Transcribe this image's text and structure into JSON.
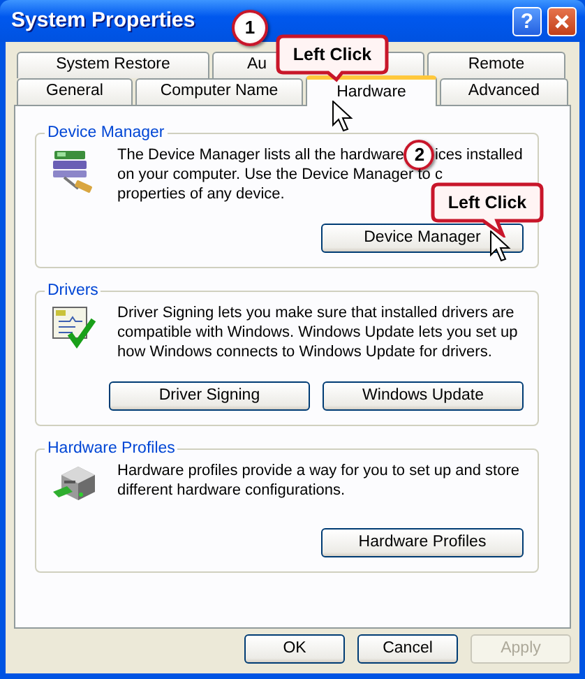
{
  "window": {
    "title": "System Properties",
    "help_button": "?"
  },
  "tab_rows": [
    [
      {
        "label": "System Restore",
        "selected": false
      },
      {
        "label": "Au",
        "selected": false
      },
      {
        "label": "Remote",
        "selected": false
      }
    ],
    [
      {
        "label": "General",
        "selected": false
      },
      {
        "label": "Computer Name",
        "selected": false
      },
      {
        "label": "Hardware",
        "selected": true
      },
      {
        "label": "Advanced",
        "selected": false
      }
    ]
  ],
  "groups": [
    {
      "title": "Device Manager",
      "kind": "device_manager",
      "lines": [
        [
          {
            "kind": "text",
            "text": "The Device Manager lists all the hardware"
          },
          {
            "kind": "step",
            "number": "2"
          },
          {
            "kind": "text",
            "text": "ices installed"
          }
        ],
        [
          {
            "kind": "text",
            "text": "on your computer. Use the Device Manager to c"
          }
        ],
        [
          {
            "kind": "text",
            "text": "properties of any device."
          }
        ]
      ],
      "buttons": [
        "Device Manager"
      ]
    },
    {
      "title": "Drivers",
      "kind": "drivers",
      "lines": [
        [
          {
            "kind": "text",
            "text": "Driver Signing lets you make sure that installed drivers are"
          }
        ],
        [
          {
            "kind": "text",
            "text": "compatible with Windows. Windows Update lets you set up"
          }
        ],
        [
          {
            "kind": "text",
            "text": "how Windows connects to Windows Update for drivers."
          }
        ]
      ],
      "buttons": [
        "Driver Signing",
        "Windows Update"
      ]
    },
    {
      "title": "Hardware Profiles",
      "kind": "profiles",
      "lines": [
        [
          {
            "kind": "text",
            "text": "Hardware profiles provide a way for you to set up and store"
          }
        ],
        [
          {
            "kind": "text",
            "text": "different hardware configurations."
          }
        ]
      ],
      "buttons": [
        "Hardware Profiles"
      ]
    }
  ],
  "footer_buttons": [
    {
      "label": "OK",
      "disabled": false
    },
    {
      "label": "Cancel",
      "disabled": false
    },
    {
      "label": "Apply",
      "disabled": true
    }
  ],
  "annotations": [
    {
      "step": "1",
      "callout": "Left Click"
    },
    {
      "callout": "Left Click"
    }
  ]
}
